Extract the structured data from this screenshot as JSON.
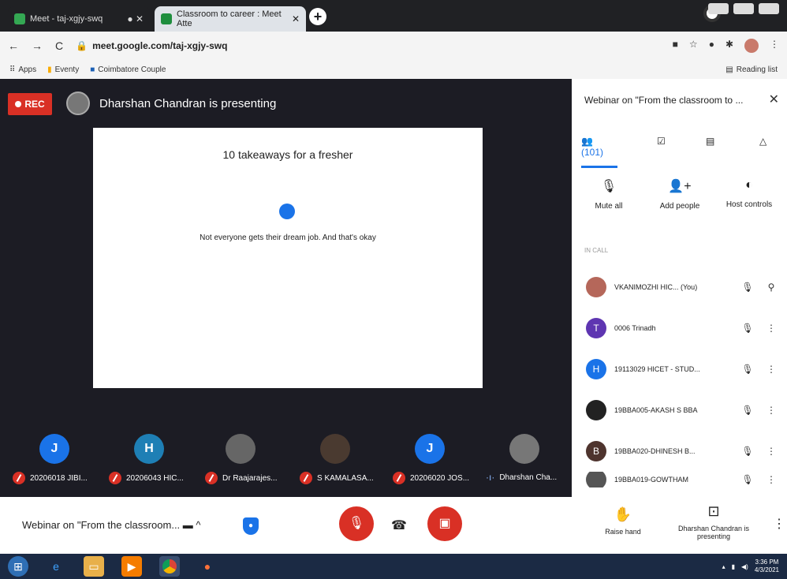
{
  "browser": {
    "tabs": [
      {
        "label": "Meet - taj-xgjy-swq",
        "active": false
      },
      {
        "label": "Classroom to career : Meet Atte",
        "active": true
      }
    ],
    "url": "meet.google.com/taj-xgjy-swq",
    "bookmarks": [
      "Apps",
      "Eventy",
      "Coimbatore Couple"
    ],
    "reading_list": "Reading list"
  },
  "meeting": {
    "rec_label": "REC",
    "presenter_text": "Dharshan Chandran is presenting",
    "slide": {
      "title": "10 takeaways for a fresher",
      "text": "Not everyone gets their dream job. And that's okay"
    },
    "tiles": [
      {
        "initial": "J",
        "color": "#1a73e8",
        "label": "20206018 JIBI...",
        "muted": true
      },
      {
        "initial": "H",
        "color": "#1e7fb5",
        "label": "20206043 HIC...",
        "muted": true
      },
      {
        "initial": "",
        "color": "#666666",
        "label": "Dr Raajarajes...",
        "muted": true
      },
      {
        "initial": "",
        "color": "#4a3a30",
        "label": "S KAMALASA...",
        "muted": true
      },
      {
        "initial": "J",
        "color": "#1a73e8",
        "label": "20206020 JOS...",
        "muted": true
      },
      {
        "initial": "",
        "color": "#777777",
        "label": "Dharshan Cha...",
        "muted": false
      }
    ]
  },
  "panel": {
    "title": "Webinar on \"From the classroom to ...",
    "people_count": "(101)",
    "actions": {
      "mute_all": "Mute all",
      "add_people": "Add people",
      "host_controls": "Host controls"
    },
    "in_call_label": "IN CALL",
    "participants": [
      {
        "initial": "",
        "color": "#b5675a",
        "name": "VKANIMOZHI HIC... (You)"
      },
      {
        "initial": "T",
        "color": "#5e35b1",
        "name": "0006 Trinadh"
      },
      {
        "initial": "H",
        "color": "#1a73e8",
        "name": "19113029 HICET - STUD..."
      },
      {
        "initial": "",
        "color": "#222222",
        "name": "19BBA005-AKASH S BBA"
      },
      {
        "initial": "B",
        "color": "#4e342e",
        "name": "19BBA020-DHINESH B..."
      },
      {
        "initial": "",
        "color": "#555555",
        "name": "19BBA019-GOWTHAM"
      }
    ]
  },
  "controls": {
    "meeting_name": "Webinar on \"From the classroom...",
    "raise_hand": "Raise hand",
    "presenting": "Dharshan Chandran is presenting"
  },
  "taskbar": {
    "time": "3:36 PM",
    "date": "4/3/2021"
  }
}
